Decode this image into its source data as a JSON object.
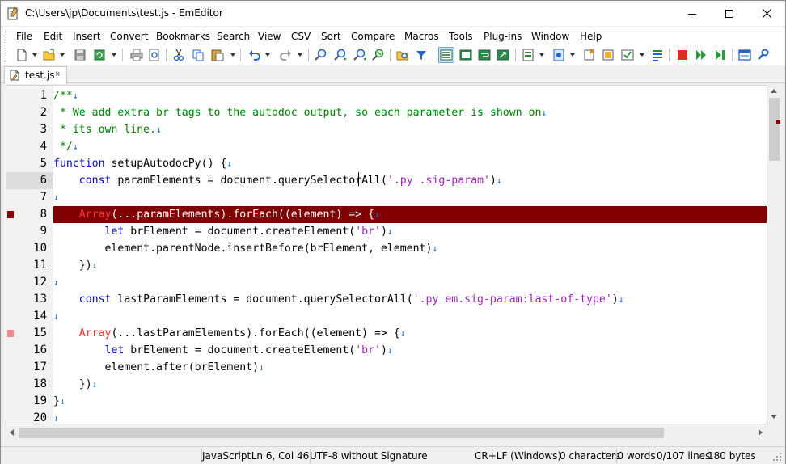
{
  "window": {
    "title": "C:\\Users\\jp\\Documents\\test.js - EmEditor",
    "app_icon": "emeditor-notepad-icon",
    "controls": {
      "minimize": "minimize-icon",
      "maximize": "maximize-icon",
      "close": "close-icon"
    }
  },
  "menu": [
    "File",
    "Edit",
    "Insert",
    "Convert",
    "Bookmarks",
    "Search",
    "View",
    "CSV",
    "Sort",
    "Compare",
    "Macros",
    "Tools",
    "Plug-ins",
    "Window",
    "Help"
  ],
  "toolbar": {
    "icons": [
      "new-file-icon",
      "open-folder-icon",
      "save-icon",
      "save-all-icon",
      "print-icon",
      "print-preview-icon",
      "cut-icon",
      "copy-icon",
      "paste-icon",
      "undo-icon",
      "redo-icon",
      "find-icon",
      "find-next-icon",
      "find-previous-icon",
      "replace-icon",
      "find-in-files-icon",
      "filter-icon",
      "wrap-none-icon",
      "wrap-window-icon",
      "wrap-page-icon",
      "wrap-ruler-icon",
      "document-type-icon",
      "config-icon",
      "bookmark-icon",
      "select-all-icon",
      "checkbox-icon",
      "list-icon",
      "stop-macro-icon",
      "run-macro-icon",
      "run-macro-step-icon",
      "panel-icon",
      "plugin-icon"
    ]
  },
  "tabs": [
    {
      "label": "test.js",
      "icon": "js-file-icon",
      "close": "×"
    }
  ],
  "editor": {
    "current_line": 6,
    "lines": [
      {
        "n": "1"
      },
      {
        "n": "2"
      },
      {
        "n": "3"
      },
      {
        "n": "4"
      },
      {
        "n": "5"
      },
      {
        "n": "6"
      },
      {
        "n": "7"
      },
      {
        "n": "8"
      },
      {
        "n": "9"
      },
      {
        "n": "10"
      },
      {
        "n": "11"
      },
      {
        "n": "12"
      },
      {
        "n": "13"
      },
      {
        "n": "14"
      },
      {
        "n": "15"
      },
      {
        "n": "16"
      },
      {
        "n": "17"
      },
      {
        "n": "18"
      },
      {
        "n": "19"
      },
      {
        "n": "20"
      }
    ],
    "tokens": {
      "l1": "/**",
      "l2": " * We add extra br tags to the autodoc output, so each parameter is shown on",
      "l3": " * its own line.",
      "l4": " */",
      "l5_kw": "function",
      "l5_rest": " setupAutodocPy() {",
      "l6_pre": "    ",
      "l6_kw": "const",
      "l6_mid": " paramElements = document.querySelectorAll(",
      "l6_str": "'.py .sig-param'",
      "l6_end": ")",
      "l8_pre": "    ",
      "l8_arr": "Array",
      "l8_rest": "(...paramElements).forEach((element) => {",
      "l9_pre": "        ",
      "l9_kw": "let",
      "l9_mid": " brElement = document.createElement(",
      "l9_str": "'br'",
      "l9_end": ")",
      "l10": "        element.parentNode.insertBefore(brElement, element)",
      "l11": "    })",
      "l13_pre": "    ",
      "l13_kw": "const",
      "l13_mid": " lastParamElements = document.querySelectorAll(",
      "l13_str": "'.py em.sig-param:last-of-type'",
      "l13_end": ")",
      "l15_pre": "    ",
      "l15_arr": "Array",
      "l15_rest": "(...lastParamElements).forEach((element) => {",
      "l16_pre": "        ",
      "l16_kw": "let",
      "l16_mid": " brElement = document.createElement(",
      "l16_str": "'br'",
      "l16_end": ")",
      "l17": "        element.after(brElement)",
      "l18": "    })",
      "l19": "}",
      "eol": "↓"
    },
    "bookmarks": [
      {
        "line": 8,
        "color": "#8b0000"
      },
      {
        "line": 15,
        "color": "#f08a8a"
      }
    ],
    "highlight_color": "#7f0000"
  },
  "status": {
    "language": "JavaScript",
    "position": "Ln 6, Col 46",
    "encoding": "UTF-8 without Signature",
    "line_ending": "CR+LF (Windows)",
    "chars": "0 characters",
    "words": "0 words",
    "lines": "0/107 lines",
    "size": "180 bytes"
  }
}
